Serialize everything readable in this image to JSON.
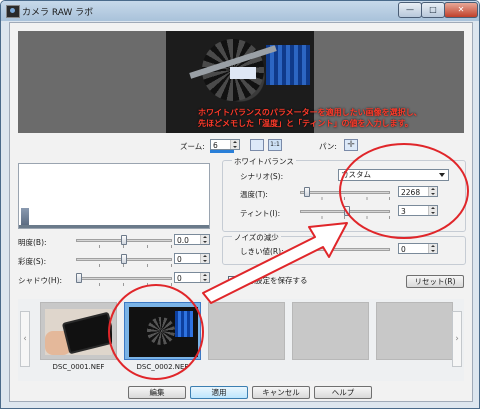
{
  "window": {
    "title": "カメラ RAW ラボ"
  },
  "titlebar_buttons": {
    "minimize": "—",
    "maximize": "□",
    "close": "✕"
  },
  "preview": {
    "annotation_line1": "ホワイトバランスのパラメーターを適用したい画像を選択し、",
    "annotation_line2": "先ほどメモした「温度」と「ティント」の値を入力します。"
  },
  "zoom": {
    "label": "ズーム:",
    "value": "6"
  },
  "pan": {
    "label": "パン:"
  },
  "white_balance": {
    "heading": "ホワイトバランス",
    "scenario_label": "シナリオ(S):",
    "scenario_value": "カスタム",
    "temperature_label": "温度(T):",
    "temperature_value": "2268",
    "temperature_level": 0.05,
    "tint_label": "ティント(I):",
    "tint_value": "3",
    "tint_level": 0.52
  },
  "noise": {
    "heading": "ノイズの減少",
    "threshold_label": "しきい値(R):",
    "threshold_value": "0",
    "threshold_level": 0.0
  },
  "adjust": {
    "brightness_label": "明度(B):",
    "brightness_value": "0.0",
    "brightness_level": 0.5,
    "saturation_label": "彩度(S):",
    "saturation_value": "0",
    "saturation_level": 0.5,
    "shadow_label": "シャドウ(H):",
    "shadow_value": "0",
    "shadow_level": 0.0
  },
  "save_settings": {
    "label": "画像設定を保存する",
    "checked": true
  },
  "reset_button": "リセット(R)",
  "filmstrip": {
    "thumbnails": [
      {
        "name": "DSC_0001.NEF"
      },
      {
        "name": "DSC_0002.NEF"
      }
    ]
  },
  "footer": {
    "edit": "編集",
    "apply": "適用",
    "cancel": "キャンセル",
    "help": "ヘルプ"
  },
  "colors": {
    "annotation": "#ff3a2a",
    "highlight_ellipse": "#e0262a"
  }
}
